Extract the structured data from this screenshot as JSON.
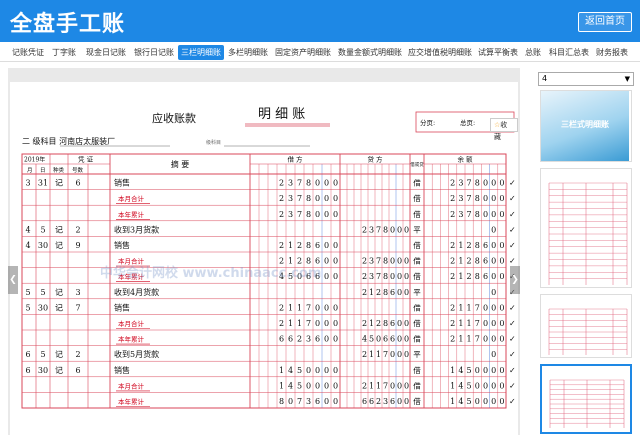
{
  "app": {
    "title": "全盘手工账",
    "back_label": "返回首页"
  },
  "tabs": [
    {
      "label": "记账凭证"
    },
    {
      "label": "丁字账"
    },
    {
      "label": "现金日记账"
    },
    {
      "label": "银行日记账"
    },
    {
      "label": "三栏明细账",
      "active": true
    },
    {
      "label": "多栏明细账"
    },
    {
      "label": "固定资产明细账"
    },
    {
      "label": "数量金额式明细账"
    },
    {
      "label": "应交增值税明细账"
    },
    {
      "label": "试算平衡表"
    },
    {
      "label": "总账"
    },
    {
      "label": "科目汇总表"
    },
    {
      "label": "财务报表"
    }
  ],
  "sidebar": {
    "page_select_value": "4",
    "cover_title": "三栏式明细账"
  },
  "ledger": {
    "title_subject": "应收账款",
    "title_main": "明 细 账",
    "subject_line": "二 级科目 河南店太服装厂",
    "sub_label": "级科目",
    "page_label": "分页:",
    "total_page_label": "总页:",
    "fav_label": "收藏",
    "watermark": "中华会计网校 www.chinaacc.com",
    "headers": {
      "year": "2019年",
      "month": "月",
      "day": "日",
      "voucher": "凭 证",
      "kind": "种类",
      "number": "号数",
      "summary": "摘 要",
      "debit": "借 方",
      "credit": "贷 方",
      "dir": "借或贷",
      "balance": "余 额"
    },
    "rows": [
      {
        "m": "3",
        "d": "31",
        "k": "记",
        "n": "6",
        "s": "销售",
        "debit": "2378000",
        "credit": "",
        "dir": "借",
        "bal": "2378000",
        "red": false,
        "check": true
      },
      {
        "m": "",
        "d": "",
        "k": "",
        "n": "",
        "s": "本月合计",
        "debit": "2378000",
        "credit": "",
        "dir": "借",
        "bal": "2378000",
        "red": true,
        "check": true
      },
      {
        "m": "",
        "d": "",
        "k": "",
        "n": "",
        "s": "本年累计",
        "debit": "2378000",
        "credit": "",
        "dir": "借",
        "bal": "2378000",
        "red": true,
        "check": true
      },
      {
        "m": "4",
        "d": "5",
        "k": "记",
        "n": "2",
        "s": "收到3月货款",
        "debit": "",
        "credit": "2378000",
        "dir": "平",
        "bal": "0",
        "red": false,
        "check": true
      },
      {
        "m": "4",
        "d": "30",
        "k": "记",
        "n": "9",
        "s": "销售",
        "debit": "2128600",
        "credit": "",
        "dir": "借",
        "bal": "2128600",
        "red": false,
        "check": true
      },
      {
        "m": "",
        "d": "",
        "k": "",
        "n": "",
        "s": "本月合计",
        "debit": "2128600",
        "credit": "2378000",
        "dir": "借",
        "bal": "2128600",
        "red": true,
        "check": true
      },
      {
        "m": "",
        "d": "",
        "k": "",
        "n": "",
        "s": "本年累计",
        "debit": "4506600",
        "credit": "2378000",
        "dir": "借",
        "bal": "2128600",
        "red": true,
        "check": true
      },
      {
        "m": "5",
        "d": "5",
        "k": "记",
        "n": "3",
        "s": "收到4月货款",
        "debit": "",
        "credit": "2128600",
        "dir": "平",
        "bal": "0",
        "red": false,
        "check": true
      },
      {
        "m": "5",
        "d": "30",
        "k": "记",
        "n": "7",
        "s": "销售",
        "debit": "2117000",
        "credit": "",
        "dir": "借",
        "bal": "2117000",
        "red": false,
        "check": true
      },
      {
        "m": "",
        "d": "",
        "k": "",
        "n": "",
        "s": "本月合计",
        "debit": "2117000",
        "credit": "2128600",
        "dir": "借",
        "bal": "2117000",
        "red": true,
        "check": true
      },
      {
        "m": "",
        "d": "",
        "k": "",
        "n": "",
        "s": "本年累计",
        "debit": "6623600",
        "credit": "4506600",
        "dir": "借",
        "bal": "2117000",
        "red": true,
        "check": true
      },
      {
        "m": "6",
        "d": "5",
        "k": "记",
        "n": "2",
        "s": "收到5月货款",
        "debit": "",
        "credit": "2117000",
        "dir": "平",
        "bal": "0",
        "red": false,
        "check": true
      },
      {
        "m": "6",
        "d": "30",
        "k": "记",
        "n": "6",
        "s": "销售",
        "debit": "1450000",
        "credit": "",
        "dir": "借",
        "bal": "1450000",
        "red": false,
        "check": true
      },
      {
        "m": "",
        "d": "",
        "k": "",
        "n": "",
        "s": "本月合计",
        "debit": "1450000",
        "credit": "2117000",
        "dir": "借",
        "bal": "1450000",
        "red": true,
        "check": true
      },
      {
        "m": "",
        "d": "",
        "k": "",
        "n": "",
        "s": "本年累计",
        "debit": "8073600",
        "credit": "6623600",
        "dir": "借",
        "bal": "1450000",
        "red": true,
        "check": true
      }
    ]
  },
  "colors": {
    "accent": "#1e88e5",
    "ledger_line": "#d9475a",
    "ink": "#111111",
    "red_ink": "#d0021b"
  },
  "icons": {
    "prev": "chevron-left-icon",
    "next": "chevron-right-icon",
    "fav": "star-icon"
  }
}
